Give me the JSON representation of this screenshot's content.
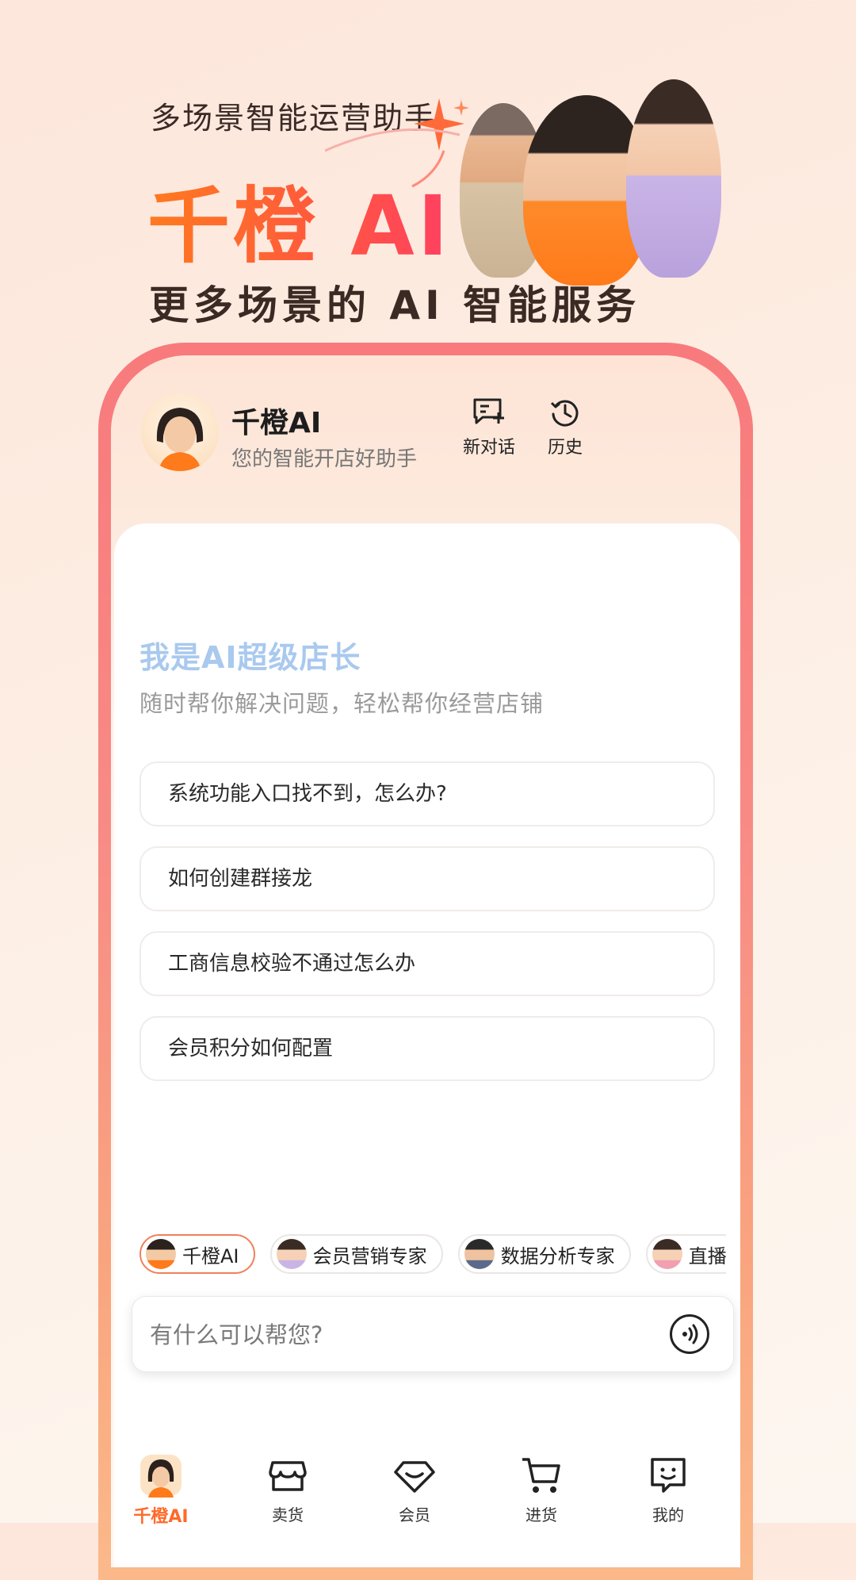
{
  "hero": {
    "subtitle": "多场景智能运营助手",
    "title": "千橙 AI",
    "tagline": "更多场景的 AI 智能服务"
  },
  "app": {
    "name": "千橙AI",
    "description": "您的智能开店好助手",
    "new_chat_label": "新对话",
    "history_label": "历史"
  },
  "welcome": {
    "headline": "我是AI超级店长",
    "subline": "随时帮你解决问题，轻松帮你经营店铺"
  },
  "suggestions": [
    "系统功能入口找不到，怎么办?",
    "如何创建群接龙",
    "工商信息校验不通过怎么办",
    "会员积分如何配置"
  ],
  "agents": [
    {
      "label": "千橙AI",
      "active": true
    },
    {
      "label": "会员营销专家",
      "active": false
    },
    {
      "label": "数据分析专家",
      "active": false
    },
    {
      "label": "直播",
      "active": false
    }
  ],
  "input": {
    "placeholder": "有什么可以帮您?"
  },
  "tabs": [
    {
      "label": "千橙AI",
      "icon": "ai-avatar-icon",
      "active": true
    },
    {
      "label": "卖货",
      "icon": "store-icon",
      "active": false
    },
    {
      "label": "会员",
      "icon": "member-gem-icon",
      "active": false
    },
    {
      "label": "进货",
      "icon": "cart-icon",
      "active": false
    },
    {
      "label": "我的",
      "icon": "smile-chat-icon",
      "active": false
    }
  ],
  "colors": {
    "brand_orange": "#ff6a2a",
    "frame_pink": "#f87a7c",
    "headline_blue": "#a9c9ee"
  }
}
